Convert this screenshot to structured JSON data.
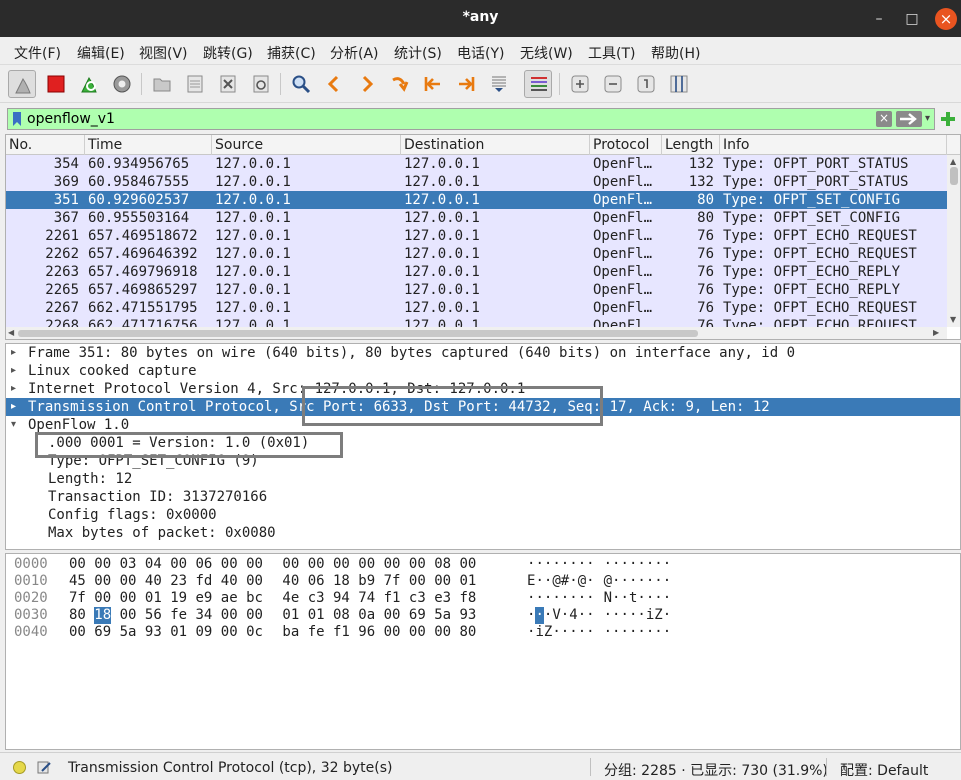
{
  "window": {
    "title": "*any",
    "min": "–",
    "max": "□",
    "close": "×"
  },
  "menu": [
    "文件(F)",
    "编辑(E)",
    "视图(V)",
    "跳转(G)",
    "捕获(C)",
    "分析(A)",
    "统计(S)",
    "电话(Y)",
    "无线(W)",
    "工具(T)",
    "帮助(H)"
  ],
  "filter": {
    "value": "openflow_v1",
    "clear": "×",
    "dropdown": "▾"
  },
  "packet_list": {
    "columns": [
      "No.",
      "Time",
      "Source",
      "Destination",
      "Protocol",
      "Length",
      "Info"
    ],
    "rows": [
      {
        "no": "354",
        "time": "60.934956765",
        "src": "127.0.0.1",
        "dst": "127.0.0.1",
        "proto": "OpenFl…",
        "len": "132",
        "info": "Type: OFPT_PORT_STATUS"
      },
      {
        "no": "369",
        "time": "60.958467555",
        "src": "127.0.0.1",
        "dst": "127.0.0.1",
        "proto": "OpenFl…",
        "len": "132",
        "info": "Type: OFPT_PORT_STATUS"
      },
      {
        "no": "351",
        "time": "60.929602537",
        "src": "127.0.0.1",
        "dst": "127.0.0.1",
        "proto": "OpenFl…",
        "len": "80",
        "info": "Type: OFPT_SET_CONFIG"
      },
      {
        "no": "367",
        "time": "60.955503164",
        "src": "127.0.0.1",
        "dst": "127.0.0.1",
        "proto": "OpenFl…",
        "len": "80",
        "info": "Type: OFPT_SET_CONFIG"
      },
      {
        "no": "2261",
        "time": "657.469518672",
        "src": "127.0.0.1",
        "dst": "127.0.0.1",
        "proto": "OpenFl…",
        "len": "76",
        "info": "Type: OFPT_ECHO_REQUEST"
      },
      {
        "no": "2262",
        "time": "657.469646392",
        "src": "127.0.0.1",
        "dst": "127.0.0.1",
        "proto": "OpenFl…",
        "len": "76",
        "info": "Type: OFPT_ECHO_REQUEST"
      },
      {
        "no": "2263",
        "time": "657.469796918",
        "src": "127.0.0.1",
        "dst": "127.0.0.1",
        "proto": "OpenFl…",
        "len": "76",
        "info": "Type: OFPT_ECHO_REPLY"
      },
      {
        "no": "2265",
        "time": "657.469865297",
        "src": "127.0.0.1",
        "dst": "127.0.0.1",
        "proto": "OpenFl…",
        "len": "76",
        "info": "Type: OFPT_ECHO_REPLY"
      },
      {
        "no": "2267",
        "time": "662.471551795",
        "src": "127.0.0.1",
        "dst": "127.0.0.1",
        "proto": "OpenFl…",
        "len": "76",
        "info": "Type: OFPT_ECHO_REQUEST"
      },
      {
        "no": "2268",
        "time": "662.471716756",
        "src": "127.0.0.1",
        "dst": "127.0.0.1",
        "proto": "OpenFl…",
        "len": "76",
        "info": "Type: OFPT_ECHO_REQUEST"
      }
    ],
    "selected_row": 2
  },
  "details": [
    {
      "text": "Frame 351: 80 bytes on wire (640 bits), 80 bytes captured (640 bits) on interface any, id 0",
      "arrow": "▸"
    },
    {
      "text": "Linux cooked capture",
      "arrow": "▸"
    },
    {
      "text": "Internet Protocol Version 4, Src: 127.0.0.1, Dst: 127.0.0.1",
      "arrow": "▸"
    },
    {
      "text": "Transmission Control Protocol, Src Port: 6633, Dst Port: 44732, Seq: 17, Ack: 9, Len: 12",
      "arrow": "▸"
    },
    {
      "text": "OpenFlow 1.0",
      "arrow": "▾"
    },
    {
      "text": ".000 0001 = Version: 1.0 (0x01)",
      "arrow": ""
    },
    {
      "text": "Type: OFPT_SET_CONFIG (9)",
      "arrow": ""
    },
    {
      "text": "Length: 12",
      "arrow": ""
    },
    {
      "text": "Transaction ID: 3137270166",
      "arrow": ""
    },
    {
      "text": "Config flags: 0x0000",
      "arrow": ""
    },
    {
      "text": "Max bytes of packet: 0x0080",
      "arrow": ""
    }
  ],
  "bytes": [
    {
      "offset": "0000",
      "hex": [
        "00",
        "00",
        "03",
        "04",
        "00",
        "06",
        "00",
        "00",
        "00",
        "00",
        "00",
        "00",
        "00",
        "00",
        "08",
        "00"
      ],
      "ascii": [
        "·",
        "·",
        "·",
        "·",
        "·",
        "·",
        "·",
        "·",
        "·",
        "·",
        "·",
        "·",
        "·",
        "·",
        "·",
        "·"
      ]
    },
    {
      "offset": "0010",
      "hex": [
        "45",
        "00",
        "00",
        "40",
        "23",
        "fd",
        "40",
        "00",
        "40",
        "06",
        "18",
        "b9",
        "7f",
        "00",
        "00",
        "01"
      ],
      "ascii": [
        "E",
        "·",
        "·",
        "@",
        "#",
        "·",
        "@",
        "·",
        "@",
        "·",
        "·",
        "·",
        "·",
        "·",
        "·",
        "·"
      ]
    },
    {
      "offset": "0020",
      "hex": [
        "7f",
        "00",
        "00",
        "01",
        "19",
        "e9",
        "ae",
        "bc",
        "4e",
        "c3",
        "94",
        "74",
        "f1",
        "c3",
        "e3",
        "f8"
      ],
      "ascii": [
        "·",
        "·",
        "·",
        "·",
        "·",
        "·",
        "·",
        "·",
        "N",
        "·",
        "·",
        "t",
        "·",
        "·",
        "·",
        "·"
      ]
    },
    {
      "offset": "0030",
      "hex": [
        "80",
        "18",
        "00",
        "56",
        "fe",
        "34",
        "00",
        "00",
        "01",
        "01",
        "08",
        "0a",
        "00",
        "69",
        "5a",
        "93"
      ],
      "ascii": [
        "·",
        "·",
        "·",
        "V",
        "·",
        "4",
        "·",
        "·",
        "·",
        "·",
        "·",
        "·",
        "·",
        "i",
        "Z",
        "·"
      ]
    },
    {
      "offset": "0040",
      "hex": [
        "00",
        "69",
        "5a",
        "93",
        "01",
        "09",
        "00",
        "0c",
        "ba",
        "fe",
        "f1",
        "96",
        "00",
        "00",
        "00",
        "80"
      ],
      "ascii": [
        "·",
        "i",
        "Z",
        "·",
        "·",
        "·",
        "·",
        "·",
        "·",
        "·",
        "·",
        "·",
        "·",
        "·",
        "·",
        "·"
      ]
    }
  ],
  "bytes_highlight": {
    "row": 3,
    "col": 1
  },
  "status": {
    "field": "Transmission Control Protocol (tcp), 32 byte(s)",
    "counts": "分组: 2285 · 已显示: 730 (31.9%)",
    "profile": "配置: Default"
  },
  "colors": {
    "selection": "#3a7ab7",
    "filter_ok": "#afffaf",
    "row_bg": "#e7e6ff",
    "record": "#e02020",
    "restart": "#3bb03b"
  }
}
